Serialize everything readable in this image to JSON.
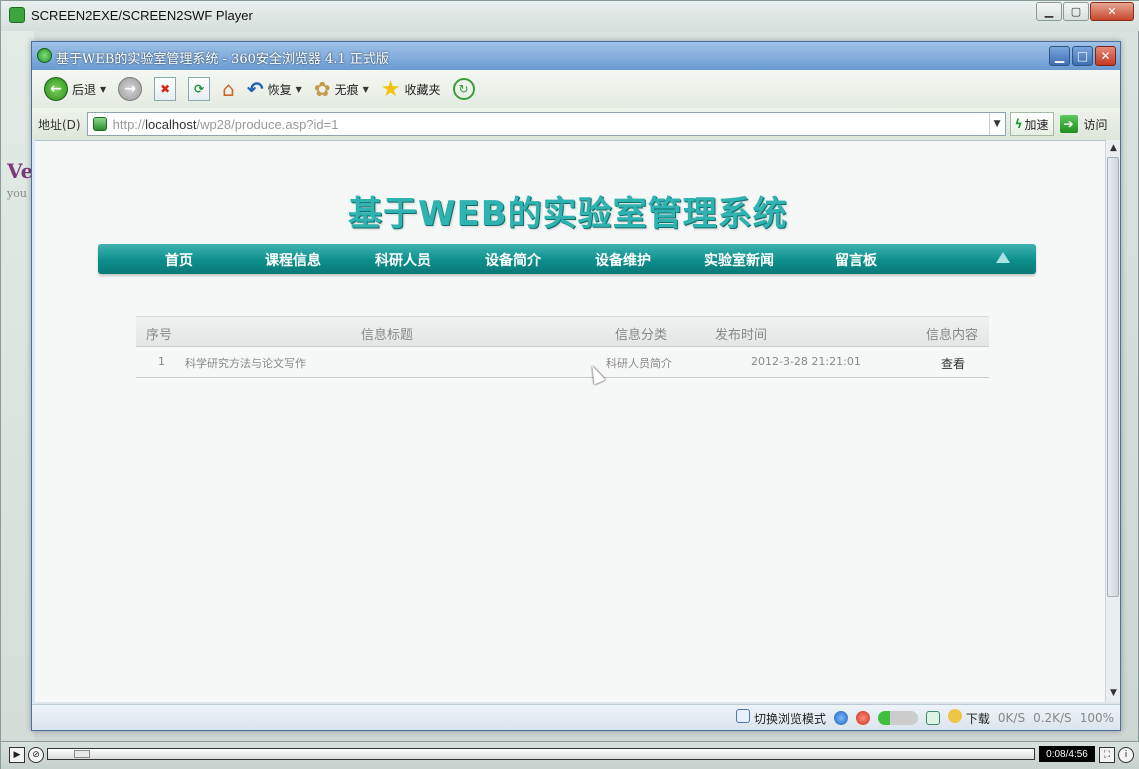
{
  "player": {
    "title": "SCREEN2EXE/SCREEN2SWF Player",
    "time": "0:08/4:56",
    "progress_fraction": 0.027
  },
  "desktop": {
    "text_big": "Ve",
    "text_small": "you"
  },
  "browser": {
    "title": "基于WEB的实验室管理系统 - 360安全浏览器 4.1 正式版",
    "toolbar": {
      "back": "后退",
      "restore": "恢复",
      "traceless": "无痕",
      "favorites": "收藏夹"
    },
    "address": {
      "label": "地址(D)",
      "url_prefix": "http://",
      "url_host": "localhost",
      "url_path": "/wp28/produce.asp?id=1",
      "speed": "加速",
      "go": "访问"
    },
    "status": {
      "mode": "切换浏览模式",
      "download": "下载",
      "down_rate": "0K/S",
      "up_rate": "0.2K/S",
      "zoom": "100%"
    }
  },
  "page": {
    "site_title": "基于WEB的实验室管理系统",
    "nav": [
      "首页",
      "课程信息",
      "科研人员",
      "设备简介",
      "设备维护",
      "实验室新闻",
      "留言板"
    ],
    "table": {
      "headers": [
        "序号",
        "信息标题",
        "信息分类",
        "发布时间",
        "信息内容"
      ],
      "rows": [
        {
          "no": "1",
          "title": "科学研究方法与论文写作",
          "category": "科研人员简介",
          "time": "2012-3-28 21:21:01",
          "action": "查看"
        }
      ]
    }
  },
  "colors": {
    "accent": "#0d8f8c",
    "title_teal": "#2eb3b1"
  }
}
